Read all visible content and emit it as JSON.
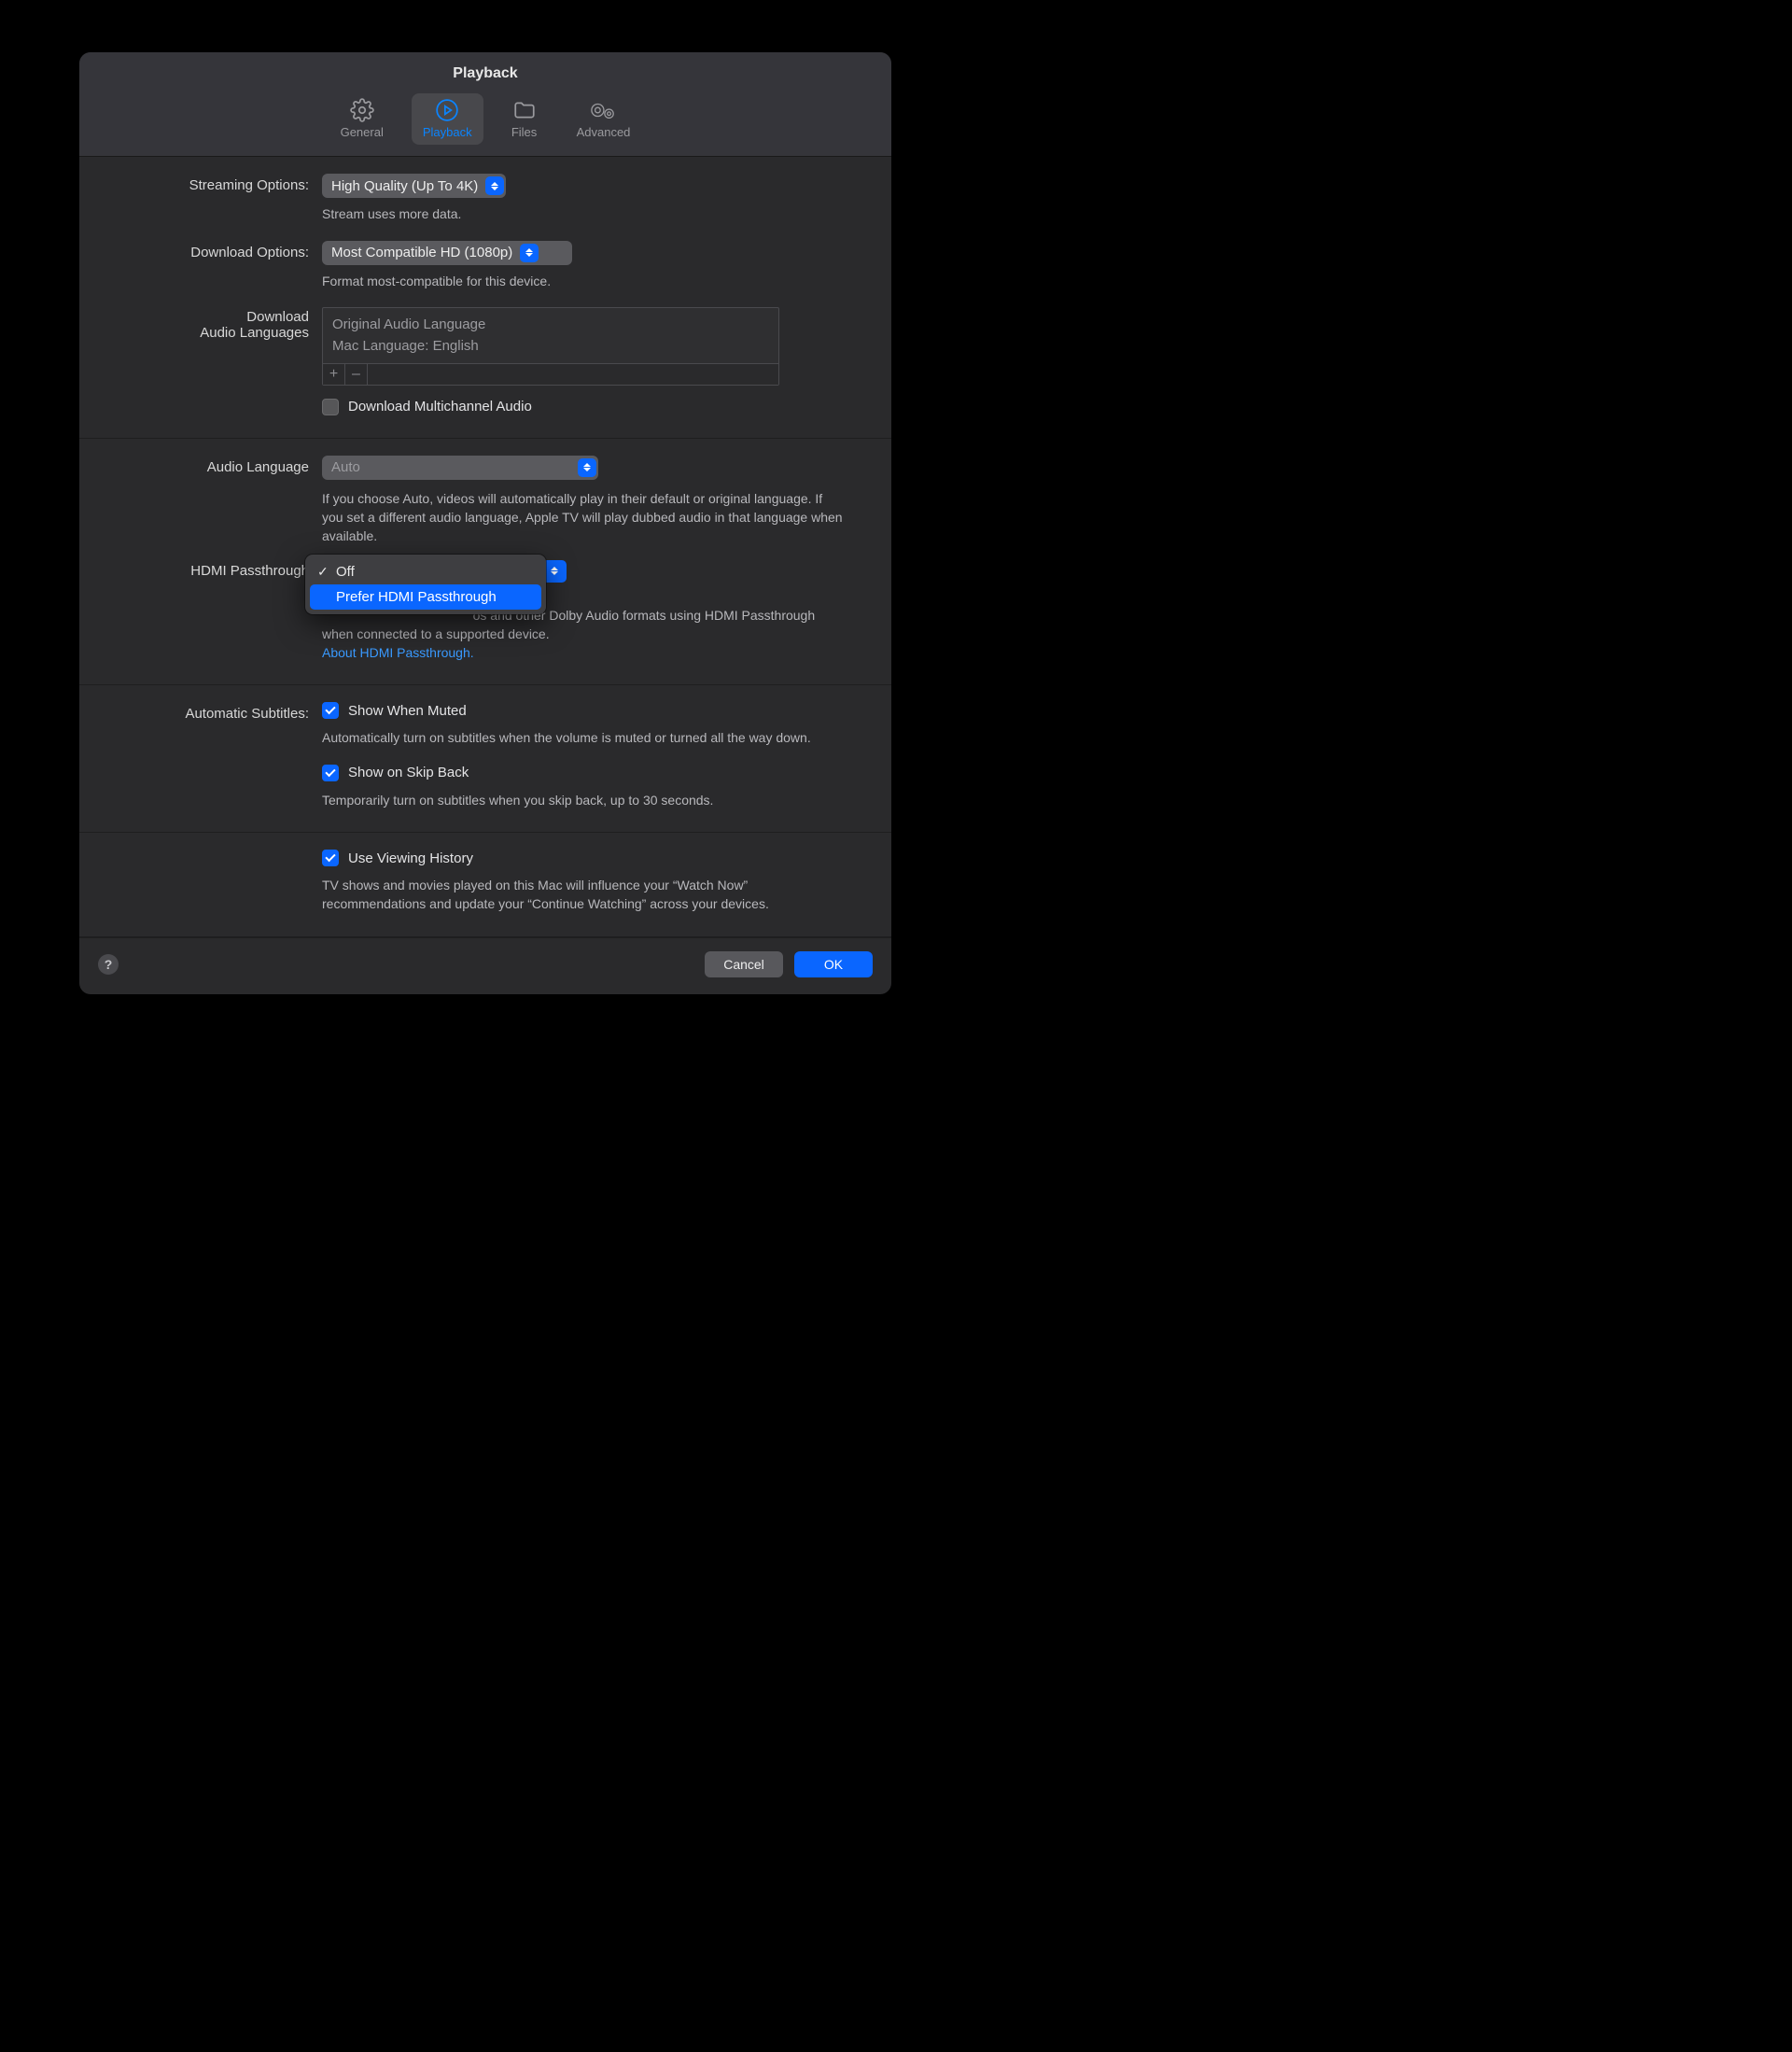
{
  "window": {
    "title": "Playback"
  },
  "tabs": {
    "general": "General",
    "playback": "Playback",
    "files": "Files",
    "advanced": "Advanced"
  },
  "streaming": {
    "label": "Streaming Options:",
    "value": "High Quality (Up To 4K)",
    "hint": "Stream uses more data."
  },
  "download": {
    "label": "Download Options:",
    "value": "Most Compatible HD (1080p)",
    "hint": "Format most-compatible for this device."
  },
  "download_langs": {
    "label_line1": "Download",
    "label_line2": "Audio Languages",
    "items": {
      "0": "Original Audio Language",
      "1": "Mac Language: English"
    },
    "add": "+",
    "remove": "–"
  },
  "multichannel": {
    "label": "Download Multichannel Audio",
    "checked": false
  },
  "audio_lang": {
    "label": "Audio Language",
    "value": "Auto",
    "desc": "If you choose Auto, videos will automatically play in their default or original language. If you set a different audio language, Apple TV will play dubbed audio in that language when available."
  },
  "hdmi": {
    "label": "HDMI Passthrough",
    "options": {
      "off": "Off",
      "prefer": "Prefer HDMI Passthrough"
    },
    "selected": "off",
    "highlighted": "prefer",
    "desc_partial": "os and other Dolby Audio formats using HDMI Passthrough when connected to a supported device.",
    "link": "About HDMI Passthrough."
  },
  "subtitles": {
    "label": "Automatic Subtitles:",
    "muted": {
      "label": "Show When Muted",
      "desc": "Automatically turn on subtitles when the volume is muted or turned all the way down."
    },
    "skipback": {
      "label": "Show on Skip Back",
      "desc": "Temporarily turn on subtitles when you skip back, up to 30 seconds."
    }
  },
  "history": {
    "label": "Use Viewing History",
    "desc": "TV shows and movies played on this Mac will influence your “Watch Now” recommendations and update your “Continue Watching” across your devices."
  },
  "footer": {
    "help": "?",
    "cancel": "Cancel",
    "ok": "OK"
  }
}
